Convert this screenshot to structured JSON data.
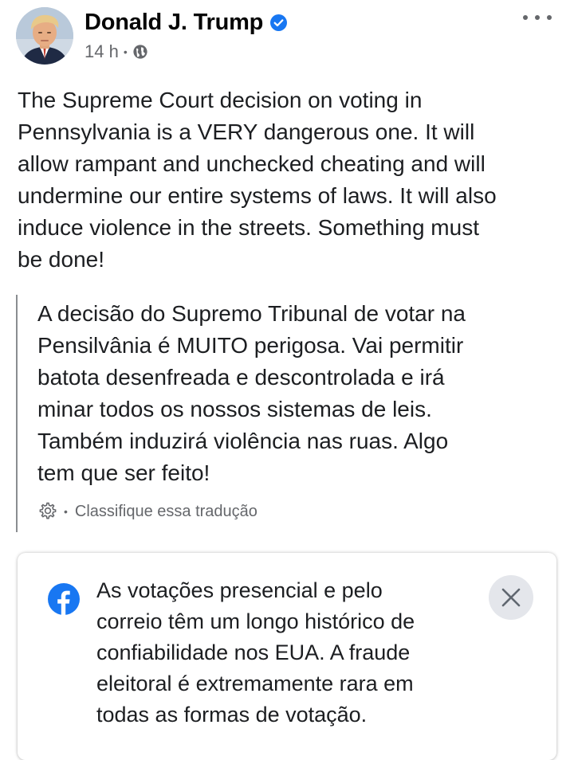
{
  "post": {
    "author": "Donald J. Trump",
    "timestamp": "14 h",
    "separator": "•",
    "verified_icon": "verified-badge-icon",
    "audience_icon": "globe-icon",
    "more_icon": "more-options-icon",
    "text": "The Supreme Court decision on voting in\nPennsylvania is a VERY dangerous one. It will\nallow rampant and unchecked cheating and will\nundermine our entire systems of laws. It will also\ninduce violence in the streets. Something must\nbe done!"
  },
  "translation": {
    "text": "A decisão do Supremo Tribunal de votar na\nPensilvânia é MUITO perigosa. Vai permitir\nbatota desenfreada e descontrolada e irá\nminar todos os nossos sistemas de leis.\nTambém induzirá violência nas ruas. Algo\ntem que ser feito!",
    "separator": "•",
    "rate_label": "Classifique essa tradução",
    "settings_icon": "gear-icon"
  },
  "info_notice": {
    "icon": "facebook-logo-icon",
    "text": "As votações presencial e pelo\ncorreio têm um longo histórico de\nconfiabilidade nos EUA. A fraude\neleitoral é extremamente rara em\ntodas as formas de votação.",
    "close_icon": "close-icon"
  },
  "colors": {
    "facebook_blue": "#1877f2",
    "secondary_text": "#65676b",
    "close_button_bg": "#e4e6eb"
  }
}
